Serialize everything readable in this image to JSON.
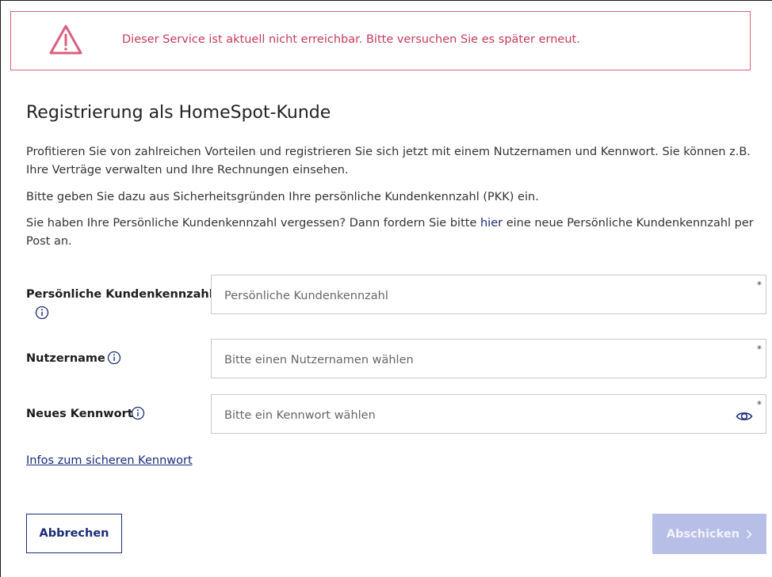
{
  "alert": {
    "icon": "warning-triangle-icon",
    "message": "Dieser Service ist aktuell nicht erreichbar. Bitte versuchen Sie es später erneut.",
    "color": "#c43a5e"
  },
  "page": {
    "title": "Registrierung als HomeSpot-Kunde",
    "intro": "Profitieren Sie von zahlreichen Vorteilen und registrieren Sie sich jetzt mit einem Nutzernamen und Kennwort. Sie können z.B. Ihre Verträge verwalten und Ihre Rechnungen einsehen.",
    "pkk_hint": "Bitte geben Sie dazu aus Sicherheitsgründen Ihre persönliche Kundenkennzahl (PKK) ein.",
    "forgot_before": "Sie haben Ihre Persönliche Kundenkennzahl vergessen? Dann fordern Sie bitte ",
    "forgot_link": "hier",
    "forgot_after": " eine neue Persönliche Kundenkennzahl per Post an."
  },
  "form": {
    "pkk": {
      "label": "Persönliche Kundenkennzahl",
      "placeholder": "Persönliche Kundenkennzahl",
      "value": "",
      "required_mark": "*"
    },
    "username": {
      "label": "Nutzername",
      "placeholder": "Bitte einen Nutzernamen wählen",
      "value": "",
      "required_mark": "*"
    },
    "password": {
      "label": "Neues Kennwort",
      "placeholder": "Bitte ein Kennwort wählen",
      "value": "",
      "required_mark": "*"
    },
    "password_info_link": "Infos zum sicheren Kennwort"
  },
  "actions": {
    "cancel_label": "Abbrechen",
    "submit_label": "Abschicken"
  },
  "colors": {
    "brand": "#1a2a7a",
    "alert_border": "#d9607f",
    "submit_disabled": "#b8bfe7"
  }
}
